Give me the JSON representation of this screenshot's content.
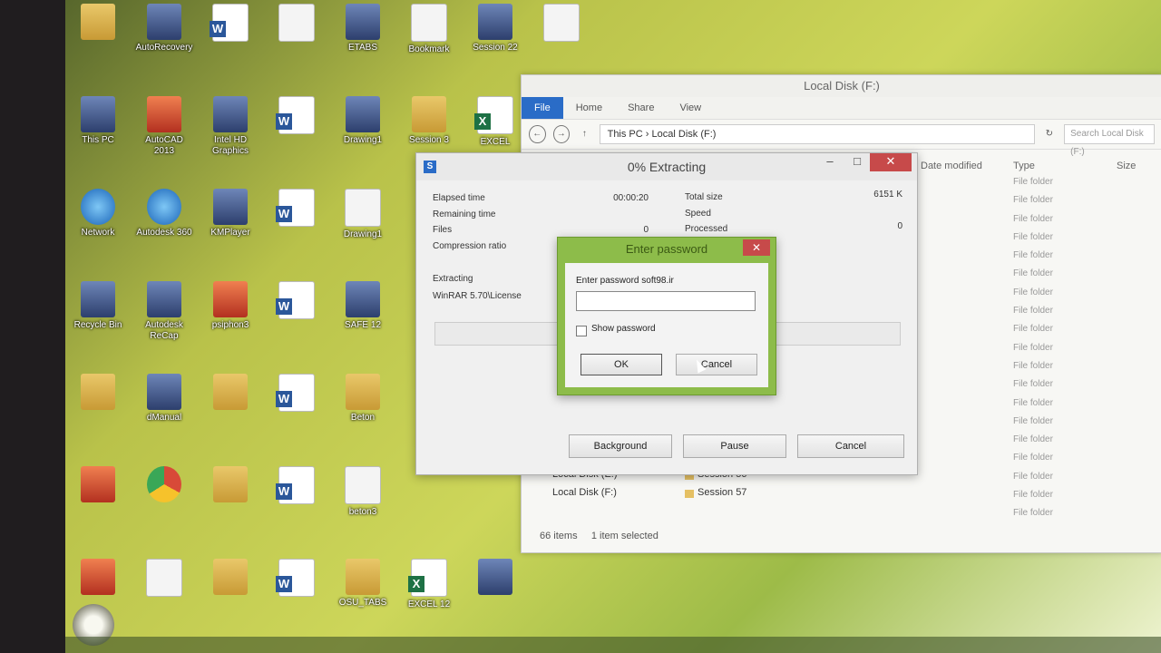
{
  "desktop": {
    "icons": [
      {
        "label": "",
        "kind": "folder",
        "col": 0,
        "row": 0
      },
      {
        "label": "AutoRecovery",
        "kind": "app",
        "col": 1,
        "row": 0
      },
      {
        "label": "",
        "kind": "word",
        "col": 2,
        "row": 0
      },
      {
        "label": "",
        "kind": "doc",
        "col": 3,
        "row": 0
      },
      {
        "label": "ETABS",
        "kind": "app",
        "col": 4,
        "row": 0
      },
      {
        "label": "Bookmark",
        "kind": "doc",
        "col": 5,
        "row": 0
      },
      {
        "label": "Session 22",
        "kind": "app",
        "col": 6,
        "row": 0
      },
      {
        "label": "",
        "kind": "doc",
        "col": 7,
        "row": 0
      },
      {
        "label": "This PC",
        "kind": "app",
        "col": 0,
        "row": 1
      },
      {
        "label": "AutoCAD 2013",
        "kind": "red",
        "col": 1,
        "row": 1
      },
      {
        "label": "Intel HD Graphics",
        "kind": "app",
        "col": 2,
        "row": 1
      },
      {
        "label": "",
        "kind": "word",
        "col": 3,
        "row": 1
      },
      {
        "label": "Drawing1",
        "kind": "app",
        "col": 4,
        "row": 1
      },
      {
        "label": "Session 3",
        "kind": "folder",
        "col": 5,
        "row": 1
      },
      {
        "label": "EXCEL",
        "kind": "excel",
        "col": 6,
        "row": 1
      },
      {
        "label": "Network",
        "kind": "globe",
        "col": 0,
        "row": 2
      },
      {
        "label": "Autodesk 360",
        "kind": "globe",
        "col": 1,
        "row": 2
      },
      {
        "label": "KMPlayer",
        "kind": "app",
        "col": 2,
        "row": 2
      },
      {
        "label": "",
        "kind": "word",
        "col": 3,
        "row": 2
      },
      {
        "label": "Drawing1",
        "kind": "doc",
        "col": 4,
        "row": 2
      },
      {
        "label": "Recycle Bin",
        "kind": "app",
        "col": 0,
        "row": 3
      },
      {
        "label": "Autodesk ReCap",
        "kind": "app",
        "col": 1,
        "row": 3
      },
      {
        "label": "psiphon3",
        "kind": "red",
        "col": 2,
        "row": 3
      },
      {
        "label": "",
        "kind": "word",
        "col": 3,
        "row": 3
      },
      {
        "label": "SAFE 12",
        "kind": "app",
        "col": 4,
        "row": 3
      },
      {
        "label": "",
        "kind": "folder",
        "col": 0,
        "row": 4
      },
      {
        "label": "dManual",
        "kind": "app",
        "col": 1,
        "row": 4
      },
      {
        "label": "",
        "kind": "folder",
        "col": 2,
        "row": 4
      },
      {
        "label": "",
        "kind": "word",
        "col": 3,
        "row": 4
      },
      {
        "label": "Beton",
        "kind": "folder",
        "col": 4,
        "row": 4
      },
      {
        "label": "",
        "kind": "red",
        "col": 0,
        "row": 5
      },
      {
        "label": "",
        "kind": "chrome",
        "col": 1,
        "row": 5
      },
      {
        "label": "",
        "kind": "folder",
        "col": 2,
        "row": 5
      },
      {
        "label": "",
        "kind": "word",
        "col": 3,
        "row": 5
      },
      {
        "label": "beton3",
        "kind": "doc",
        "col": 4,
        "row": 5
      },
      {
        "label": "",
        "kind": "red",
        "col": 0,
        "row": 6
      },
      {
        "label": "",
        "kind": "doc",
        "col": 1,
        "row": 6
      },
      {
        "label": "",
        "kind": "folder",
        "col": 2,
        "row": 6
      },
      {
        "label": "",
        "kind": "word",
        "col": 3,
        "row": 6
      },
      {
        "label": "OSU_TABS",
        "kind": "folder",
        "col": 4,
        "row": 6
      },
      {
        "label": "EXCEL 12",
        "kind": "excel",
        "col": 5,
        "row": 6
      },
      {
        "label": "",
        "kind": "app",
        "col": 6,
        "row": 6
      }
    ]
  },
  "explorer": {
    "title": "Local Disk (F:)",
    "tabs": [
      "File",
      "Home",
      "Share",
      "View"
    ],
    "path_this_pc": "This PC",
    "path_drive": "Local Disk (F:)",
    "search_placeholder": "Search Local Disk (F:)",
    "col_modified": "Date modified",
    "col_type": "Type",
    "col_size": "Size",
    "rows": [
      {
        "type": "File folder"
      },
      {
        "type": "File folder"
      },
      {
        "type": "File folder"
      },
      {
        "type": "File folder"
      },
      {
        "type": "File folder"
      },
      {
        "type": "File folder"
      },
      {
        "type": "File folder"
      },
      {
        "type": "File folder"
      },
      {
        "type": "File folder"
      },
      {
        "type": "File folder"
      },
      {
        "type": "File folder"
      },
      {
        "type": "File folder"
      },
      {
        "type": "File folder"
      },
      {
        "type": "File folder"
      },
      {
        "type": "File folder"
      },
      {
        "type": "File folder"
      },
      {
        "type": "File folder"
      },
      {
        "type": "File folder"
      },
      {
        "type": "File folder"
      }
    ],
    "nav_items": [
      "Local Disk (E:)",
      "Local Disk (F:)"
    ],
    "files": [
      "Session 56",
      "Session 57"
    ],
    "status_items": "66 items",
    "status_selected": "1 item selected"
  },
  "extract_dialog": {
    "title": "0% Extracting",
    "elapsed_label": "Elapsed time",
    "elapsed_value": "00:00:20",
    "remaining_label": "Remaining time",
    "files_label": "Files",
    "files_value": "0",
    "compression_label": "Compression ratio",
    "total_label": "Total size",
    "total_value": "6151 K",
    "speed_label": "Speed",
    "processed_label": "Processed",
    "processed_value": "0",
    "extracting_label": "Extracting",
    "extracting_path": "WinRAR 5.70\\License",
    "progress_fraction": 0,
    "background_btn": "Background",
    "pause_btn": "Pause",
    "cancel_btn": "Cancel"
  },
  "password_dialog": {
    "title": "Enter password",
    "prompt": "Enter password  soft98.ir",
    "show_password": "Show password",
    "ok": "OK",
    "cancel": "Cancel"
  },
  "colors": {
    "accent": "#2a6cc7",
    "dialog_frame": "#8dbc4a",
    "close_red": "#c74a4a"
  }
}
